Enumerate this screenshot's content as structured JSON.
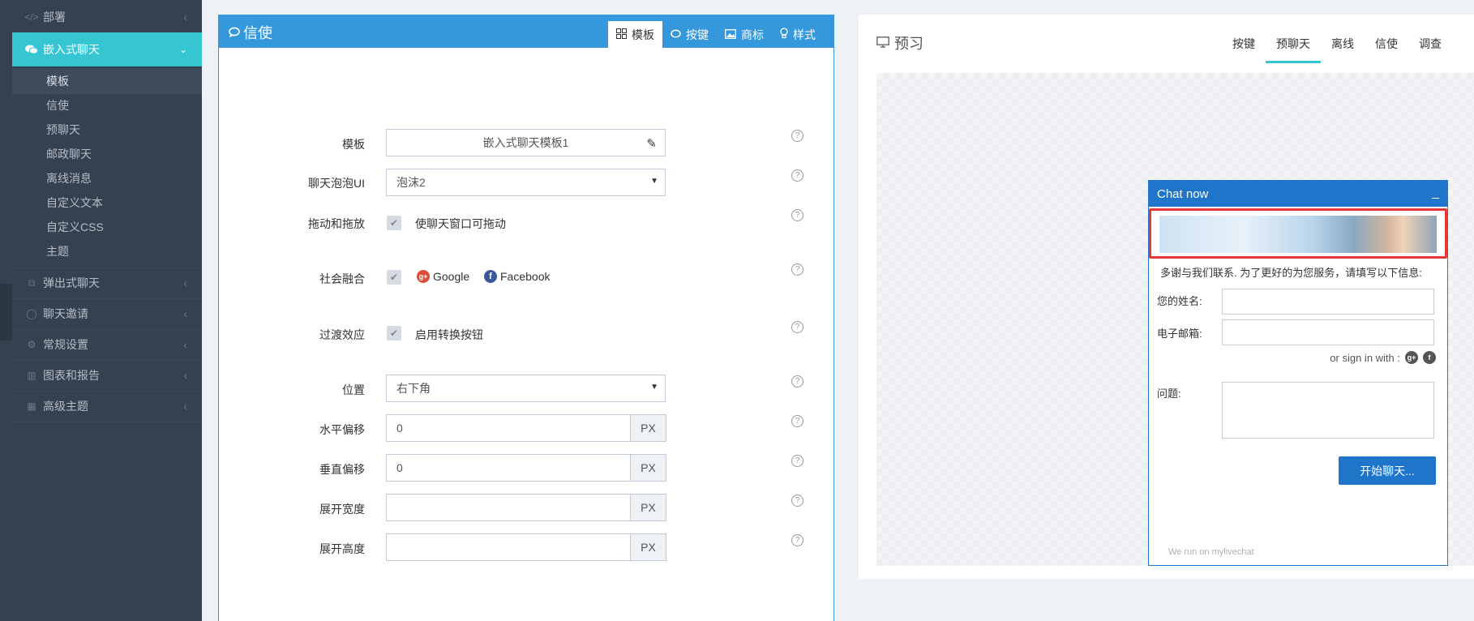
{
  "sidebar": {
    "items": [
      {
        "label": "部署",
        "icon": "code-icon"
      },
      {
        "label": "嵌入式聊天",
        "icon": "comments-icon"
      },
      {
        "label": "弹出式聊天",
        "icon": "external-link-icon"
      },
      {
        "label": "聊天邀请",
        "icon": "comment-icon"
      },
      {
        "label": "常规设置",
        "icon": "cogs-icon"
      },
      {
        "label": "图表和报告",
        "icon": "bar-chart-icon"
      },
      {
        "label": "高级主题",
        "icon": "table-icon"
      }
    ],
    "subitems": [
      "模板",
      "信使",
      "预聊天",
      "邮政聊天",
      "离线消息",
      "自定义文本",
      "自定义CSS",
      "主题"
    ]
  },
  "panel": {
    "title": "信使",
    "tabs": [
      "模板",
      "按键",
      "商标",
      "样式"
    ]
  },
  "form": {
    "template_label": "模板",
    "template_value": "嵌入式聊天模板1",
    "bubble_label": "聊天泡泡UI",
    "bubble_value": "泡沫2",
    "drag_label": "拖动和拖放",
    "drag_text": "使聊天窗口可拖动",
    "social_label": "社会融合",
    "social_google": "Google",
    "social_facebook": "Facebook",
    "transition_label": "过渡效应",
    "transition_text": "启用转换按钮",
    "position_label": "位置",
    "position_value": "右下角",
    "hoffset_label": "水平偏移",
    "hoffset_value": "0",
    "voffset_label": "垂直偏移",
    "voffset_value": "0",
    "width_label": "展开宽度",
    "height_label": "展开高度",
    "unit": "PX"
  },
  "preview": {
    "title": "预习",
    "tabs": [
      "按键",
      "预聊天",
      "离线",
      "信使",
      "调查"
    ],
    "chat": {
      "header": "Chat now",
      "minimize": "_",
      "intro": "多谢与我们联系. 为了更好的为您服务，请填写以下信息:",
      "name_label": "您的姓名:",
      "email_label": "电子邮箱:",
      "signin": "or sign in with :",
      "question_label": "问题:",
      "start_button": "开始聊天...",
      "powered": "We run on mylivechat"
    }
  },
  "colors": {
    "sidebar_bg": "#364150",
    "active_item": "#36c6d3",
    "panel_blue": "#3598dc",
    "chat_blue": "#1e75c9",
    "highlight_red": "#e53935"
  }
}
